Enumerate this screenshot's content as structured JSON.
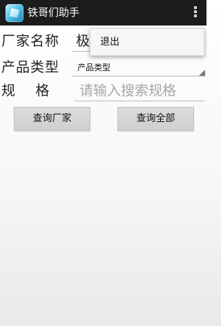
{
  "action_bar": {
    "title": "铁哥们助手",
    "app_icon": "cube-app-icon",
    "overflow_icon": "overflow-menu-icon"
  },
  "form": {
    "vendor_label": "厂家名称",
    "vendor_value": "极",
    "type_label": "产品类型",
    "type_selected": "产品类型",
    "spec_label": "规　 格",
    "spec_placeholder": "请输入搜索规格"
  },
  "buttons": {
    "query_vendor": "查询厂家",
    "query_all": "查询全部"
  },
  "overflow_menu": {
    "items": [
      "退出"
    ]
  }
}
